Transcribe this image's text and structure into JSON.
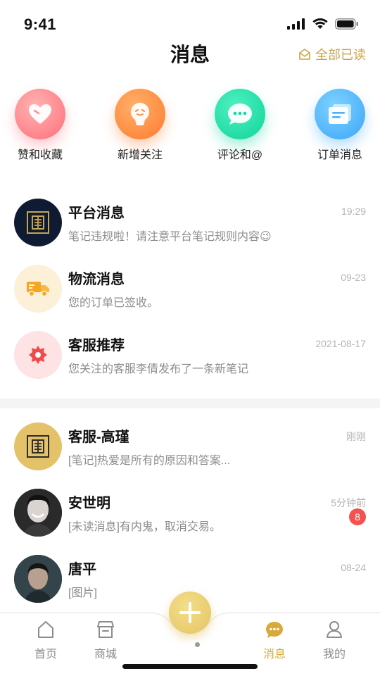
{
  "status_bar": {
    "time": "9:41"
  },
  "header": {
    "title": "消息",
    "mark_all_read": "全部已读"
  },
  "quick_actions": [
    {
      "label": "赞和收藏",
      "icon": "heart-icon"
    },
    {
      "label": "新增关注",
      "icon": "follower-face-icon"
    },
    {
      "label": "评论和@",
      "icon": "comment-bubble-icon"
    },
    {
      "label": "订单消息",
      "icon": "order-document-icon"
    }
  ],
  "system_messages": [
    {
      "name": "平台消息",
      "preview": "笔记违规啦！请注意平台笔记规则内容😉",
      "time": "19:29",
      "avatar": "platform-logo-dark"
    },
    {
      "name": "物流消息",
      "preview": "您的订单已签收。",
      "time": "09-23",
      "avatar": "truck-icon"
    },
    {
      "name": "客服推荐",
      "preview": "您关注的客服李倩发布了一条新笔记",
      "time": "2021-08-17",
      "avatar": "flower-badge-icon"
    }
  ],
  "chat_messages": [
    {
      "name": "客服-高瑾",
      "preview": "[笔记]热爱是所有的原因和答案...",
      "time": "刚刚",
      "badge": "",
      "avatar": "platform-logo-gold"
    },
    {
      "name": "安世明",
      "preview": "[未读消息]有内鬼，取消交易。",
      "time": "5分钟前",
      "badge": "8",
      "avatar": "user-photo"
    },
    {
      "name": "唐平",
      "preview": "[图片]",
      "time": "08-24",
      "badge": "",
      "avatar": "user-photo"
    }
  ],
  "tabbar": {
    "tabs": [
      {
        "label": "首页",
        "icon": "home-icon",
        "active": false
      },
      {
        "label": "商城",
        "icon": "shop-icon",
        "active": false
      },
      {
        "label": "消息",
        "icon": "message-icon",
        "active": true
      },
      {
        "label": "我的",
        "icon": "profile-icon",
        "active": false
      }
    ],
    "center_action": "plus-icon"
  },
  "colors": {
    "accent": "#d9a93a",
    "badge": "#f4514f",
    "divider": "#f4f4f4"
  }
}
